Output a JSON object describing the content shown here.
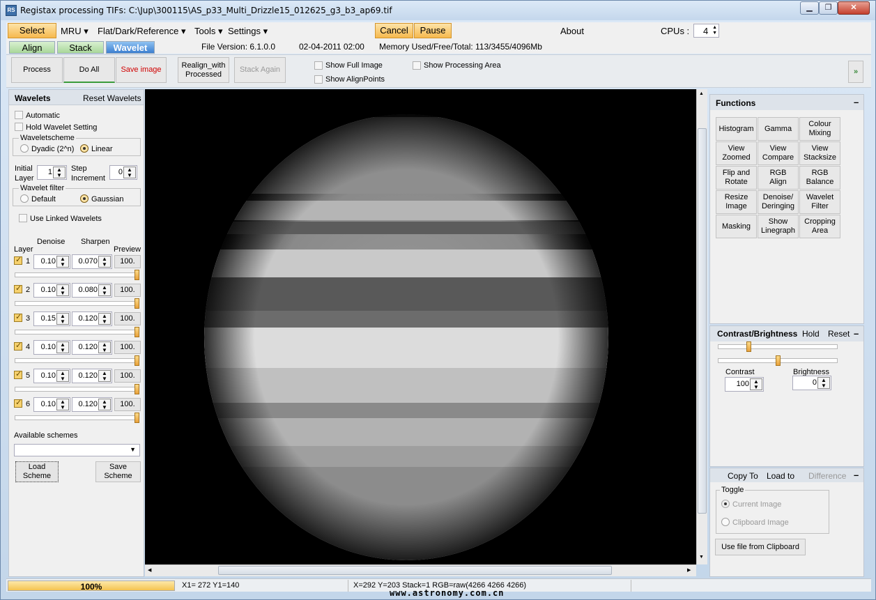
{
  "window": {
    "title": "Registax processing TIFs: C:\\Jup\\300115\\AS_p33_Multi_Drizzle15_012625_g3_b3_ap69.tif",
    "app_icon_text": "RS",
    "min": "▁",
    "max": "❐",
    "close": "✕"
  },
  "menu": {
    "select": "Select",
    "mru": "MRU",
    "flat": "Flat/Dark/Reference",
    "tools": "Tools",
    "settings": "Settings",
    "cancel": "Cancel",
    "pause": "Pause",
    "about": "About",
    "cpus_label": "CPUs :",
    "cpus_value": "4"
  },
  "tabs": {
    "align": "Align",
    "stack": "Stack",
    "wavelet": "Wavelet"
  },
  "info": {
    "file_version": "File Version: 6.1.0.0",
    "date": "02-04-2011 02:00",
    "memory": "Memory Used/Free/Total: 113/3455/4096Mb"
  },
  "toolbar": {
    "process": "Process",
    "do_all": "Do All",
    "save_image": "Save image",
    "realign_1": "Realign_with",
    "realign_2": "Processed",
    "stack_again": "Stack Again",
    "show_full_image": "Show Full Image",
    "show_alignpoints": "Show AlignPoints",
    "show_processing_area": "Show Processing Area",
    "expand": "»"
  },
  "wavelets": {
    "title": "Wavelets",
    "reset": "Reset Wavelets",
    "automatic": "Automatic",
    "hold": "Hold Wavelet Setting",
    "scheme_group": "Waveletscheme",
    "dyadic": "Dyadic (2^n)",
    "linear": "Linear",
    "initial_1": "Initial",
    "initial_2": "Layer",
    "initial_value": "1",
    "step_1": "Step",
    "step_2": "Increment",
    "step_value": "0",
    "filter_group": "Wavelet filter",
    "default": "Default",
    "gaussian": "Gaussian",
    "linked": "Use Linked Wavelets",
    "col_layer": "Layer",
    "col_denoise": "Denoise",
    "col_sharpen": "Sharpen",
    "col_preview": "Preview",
    "layers": [
      {
        "num": "1",
        "denoise": "0.10",
        "sharpen": "0.070",
        "preview": "100."
      },
      {
        "num": "2",
        "denoise": "0.10",
        "sharpen": "0.080",
        "preview": "100."
      },
      {
        "num": "3",
        "denoise": "0.15",
        "sharpen": "0.120",
        "preview": "100."
      },
      {
        "num": "4",
        "denoise": "0.10",
        "sharpen": "0.120",
        "preview": "100."
      },
      {
        "num": "5",
        "denoise": "0.10",
        "sharpen": "0.120",
        "preview": "100."
      },
      {
        "num": "6",
        "denoise": "0.10",
        "sharpen": "0.120",
        "preview": "100."
      }
    ],
    "available": "Available schemes",
    "load_1": "Load",
    "load_2": "Scheme",
    "save_1": "Save",
    "save_2": "Scheme"
  },
  "functions": {
    "title": "Functions",
    "collapse": "–",
    "buttons": [
      [
        "Histogram",
        ""
      ],
      [
        "Gamma",
        ""
      ],
      [
        "Colour",
        "Mixing"
      ],
      [
        "View",
        "Zoomed"
      ],
      [
        "View",
        "Compare"
      ],
      [
        "View",
        "Stacksize"
      ],
      [
        "Flip and",
        "Rotate"
      ],
      [
        "RGB",
        "Align"
      ],
      [
        "RGB",
        "Balance"
      ],
      [
        "Resize",
        "Image"
      ],
      [
        "Denoise/",
        "Deringing"
      ],
      [
        "Wavelet",
        "Filter"
      ],
      [
        "Masking",
        ""
      ],
      [
        "Show",
        "Linegraph"
      ],
      [
        "Cropping",
        "Area"
      ]
    ]
  },
  "contrast": {
    "title": "Contrast/Brightness",
    "hold": "Hold",
    "reset": "Reset",
    "contrast_label": "Contrast",
    "contrast_value": "100",
    "brightness_label": "Brightness",
    "brightness_value": "0",
    "collapse": "–"
  },
  "copy": {
    "copy_to": "Copy To",
    "load_to": "Load to",
    "difference": "Difference",
    "toggle": "Toggle",
    "current": "Current Image",
    "clipboard": "Clipboard Image",
    "use_file": "Use file from Clipboard",
    "collapse": "–"
  },
  "status": {
    "progress": "100%",
    "progress_value": 1.0,
    "xy": "X1= 272 Y1=140",
    "pixel": "X=292 Y=203 Stack=1 RGB=raw(4266 4266 4266)",
    "watermark": "www.astronomy.com.cn"
  },
  "colors": {
    "accent_orange": "#f6b94e",
    "tab_active": "#3c7fd0"
  }
}
